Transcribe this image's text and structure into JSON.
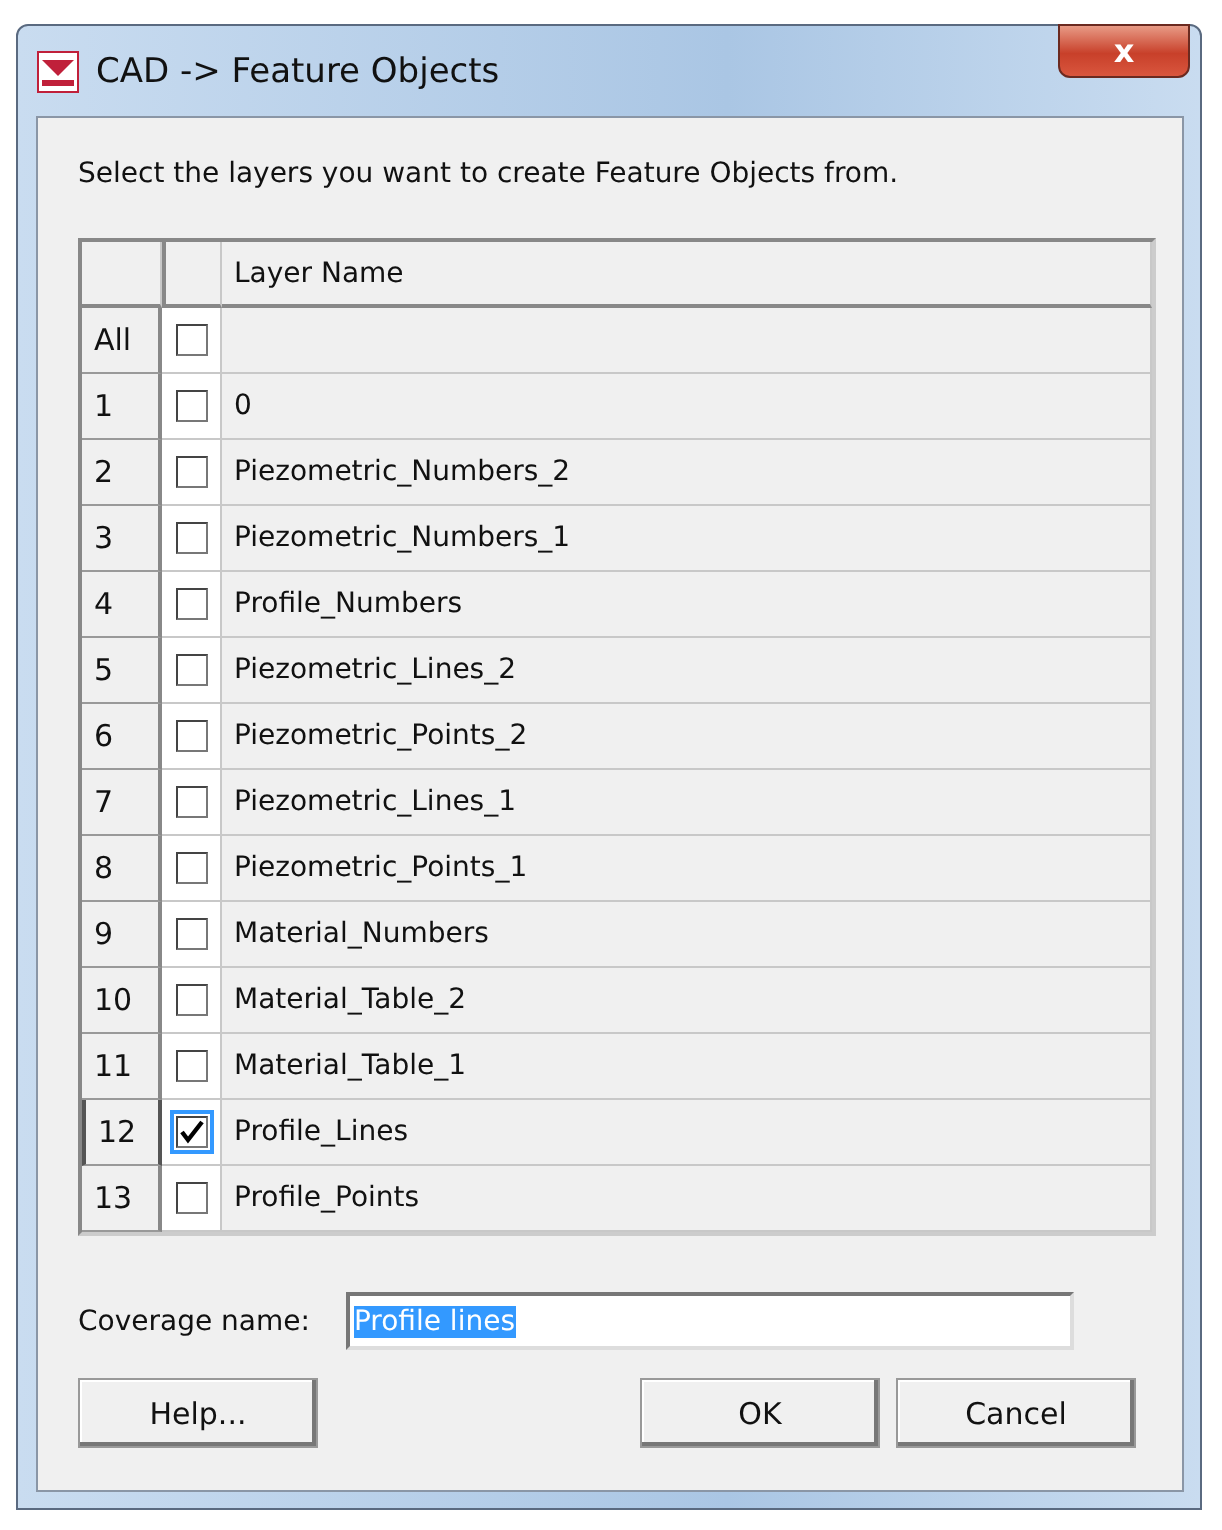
{
  "window": {
    "title": "CAD -> Feature Objects",
    "close_glyph": "x"
  },
  "instruction": "Select the layers you want to create Feature Objects from.",
  "table": {
    "columns": [
      "Layer Name"
    ],
    "all_row": {
      "label": "All",
      "checked": false
    },
    "rows": [
      {
        "number": "1",
        "name": "0",
        "checked": false,
        "focused": false
      },
      {
        "number": "2",
        "name": "Piezometric_Numbers_2",
        "checked": false,
        "focused": false
      },
      {
        "number": "3",
        "name": "Piezometric_Numbers_1",
        "checked": false,
        "focused": false
      },
      {
        "number": "4",
        "name": "Profile_Numbers",
        "checked": false,
        "focused": false
      },
      {
        "number": "5",
        "name": "Piezometric_Lines_2",
        "checked": false,
        "focused": false
      },
      {
        "number": "6",
        "name": "Piezometric_Points_2",
        "checked": false,
        "focused": false
      },
      {
        "number": "7",
        "name": "Piezometric_Lines_1",
        "checked": false,
        "focused": false
      },
      {
        "number": "8",
        "name": "Piezometric_Points_1",
        "checked": false,
        "focused": false
      },
      {
        "number": "9",
        "name": "Material_Numbers",
        "checked": false,
        "focused": false
      },
      {
        "number": "10",
        "name": "Material_Table_2",
        "checked": false,
        "focused": false
      },
      {
        "number": "11",
        "name": "Material_Table_1",
        "checked": false,
        "focused": false
      },
      {
        "number": "12",
        "name": "Profile_Lines",
        "checked": true,
        "focused": true
      },
      {
        "number": "13",
        "name": "Profile_Points",
        "checked": false,
        "focused": false
      }
    ]
  },
  "coverage": {
    "label": "Coverage name:",
    "value": "Profile lines",
    "text_selected": true
  },
  "buttons": [
    {
      "label": "Help...",
      "kind": "left"
    },
    {
      "label": "OK",
      "kind": "right"
    },
    {
      "label": "Cancel",
      "kind": "right"
    }
  ]
}
